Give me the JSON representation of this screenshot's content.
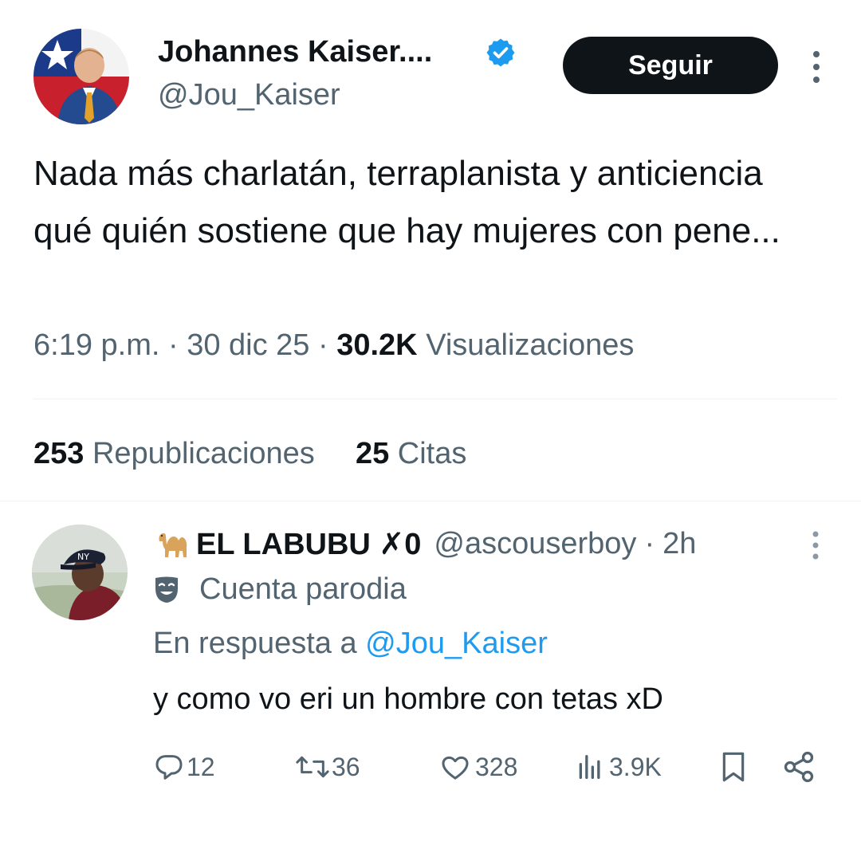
{
  "post": {
    "author_name": "Johannes Kaiser....",
    "author_handle": "@Jou_Kaiser",
    "follow_label": "Seguir",
    "text": "Nada más charlatán,  terraplanista y anticiencia qué quién sostiene que hay mujeres con pene...",
    "time": "6:19 p.m.",
    "date": "30 dic 25",
    "views_count": "30.2K",
    "views_label": "Visualizaciones",
    "reposts_count": "253",
    "reposts_label": "Republicaciones",
    "quotes_count": "25",
    "quotes_label": "Citas"
  },
  "reply": {
    "name": "EL LABUBU ✗0",
    "handle": "@ascouserboy",
    "age": "2h",
    "badge_label": "Cuenta parodia",
    "in_reply_prefix": "En respuesta a",
    "in_reply_mention": "@Jou_Kaiser",
    "text": "y como vo eri un hombre con tetas xD",
    "actions": {
      "replies": "12",
      "reposts": "36",
      "likes": "328",
      "views": "3.9K"
    }
  },
  "colors": {
    "text_primary": "#0f1419",
    "text_secondary": "#536471",
    "accent_blue": "#1d9bf0",
    "button_dark": "#0f1419"
  },
  "icons": [
    "verified-badge-icon",
    "more-options-icon",
    "camel-emoji-icon",
    "parody-mask-icon",
    "reply-icon",
    "repost-icon",
    "like-icon",
    "views-icon",
    "bookmark-icon",
    "share-icon"
  ]
}
